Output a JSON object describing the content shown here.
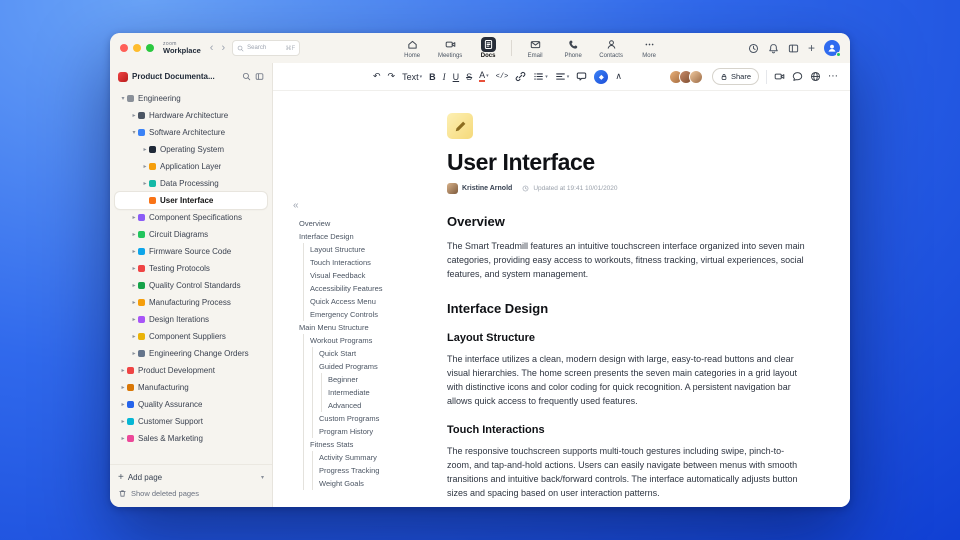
{
  "titlebar": {
    "brand_small": "zoom",
    "brand_name": "Workplace",
    "back_glyph": "‹",
    "forward_glyph": "›",
    "plus_glyph": "+",
    "search": {
      "placeholder": "Search",
      "shortcut": "⌘F"
    },
    "tabs": [
      {
        "label": "Home",
        "icon": "home-icon"
      },
      {
        "label": "Meetings",
        "icon": "video-camera-icon"
      },
      {
        "label": "Docs",
        "icon": "document-icon",
        "active": true,
        "divider_after": true
      },
      {
        "label": "Email",
        "icon": "envelope-icon"
      },
      {
        "label": "Phone",
        "icon": "phone-icon"
      },
      {
        "label": "Contacts",
        "icon": "contacts-icon"
      },
      {
        "label": "More",
        "icon": "more-dots-icon"
      }
    ]
  },
  "sidebar": {
    "workspace_title": "Product Documenta...",
    "add_page_label": "Add page",
    "add_page_plus_glyph": "+",
    "add_page_chevron_glyph": "▾",
    "show_deleted_label": "Show deleted pages",
    "tree": [
      {
        "label": "Engineering",
        "depth": 0,
        "chevron": "down",
        "icon": "gear-icon",
        "color": "#8a9099"
      },
      {
        "label": "Hardware Architecture",
        "depth": 1,
        "chevron": "right",
        "icon": "chip-icon",
        "color": "#4b5563"
      },
      {
        "label": "Software Architecture",
        "depth": 1,
        "chevron": "down",
        "icon": "layers-icon",
        "color": "#3b82f6"
      },
      {
        "label": "Operating System",
        "depth": 2,
        "chevron": "right",
        "icon": "cpu-icon",
        "color": "#1f2937"
      },
      {
        "label": "Application Layer",
        "depth": 2,
        "chevron": "right",
        "icon": "window-icon",
        "color": "#f59e0b"
      },
      {
        "label": "Data Processing",
        "depth": 2,
        "chevron": "right",
        "icon": "database-icon",
        "color": "#14b8a6"
      },
      {
        "label": "User Interface",
        "depth": 2,
        "chevron": "none",
        "icon": "palette-icon",
        "color": "#f97316",
        "selected": true
      },
      {
        "label": "Component Specifications",
        "depth": 1,
        "chevron": "right",
        "icon": "clipboard-icon",
        "color": "#8b5cf6"
      },
      {
        "label": "Circuit Diagrams",
        "depth": 1,
        "chevron": "right",
        "icon": "circuit-icon",
        "color": "#22c55e"
      },
      {
        "label": "Firmware Source Code",
        "depth": 1,
        "chevron": "right",
        "icon": "code-file-icon",
        "color": "#0ea5e9"
      },
      {
        "label": "Testing Protocols",
        "depth": 1,
        "chevron": "right",
        "icon": "flask-icon",
        "color": "#ef4444"
      },
      {
        "label": "Quality Control Standards",
        "depth": 1,
        "chevron": "right",
        "icon": "check-badge-icon",
        "color": "#16a34a"
      },
      {
        "label": "Manufacturing Process",
        "depth": 1,
        "chevron": "right",
        "icon": "factory-icon",
        "color": "#f59e0b"
      },
      {
        "label": "Design Iterations",
        "depth": 1,
        "chevron": "right",
        "icon": "loop-icon",
        "color": "#a855f7"
      },
      {
        "label": "Component Suppliers",
        "depth": 1,
        "chevron": "right",
        "icon": "box-icon",
        "color": "#eab308"
      },
      {
        "label": "Engineering Change Orders",
        "depth": 1,
        "chevron": "right",
        "icon": "file-icon",
        "color": "#64748b"
      },
      {
        "label": "Product Development",
        "depth": 0,
        "chevron": "right",
        "icon": "rocket-icon",
        "color": "#ef4444"
      },
      {
        "label": "Manufacturing",
        "depth": 0,
        "chevron": "right",
        "icon": "wrench-icon",
        "color": "#d97706"
      },
      {
        "label": "Quality Assurance",
        "depth": 0,
        "chevron": "right",
        "icon": "shield-icon",
        "color": "#2563eb"
      },
      {
        "label": "Customer Support",
        "depth": 0,
        "chevron": "right",
        "icon": "headset-icon",
        "color": "#06b6d4"
      },
      {
        "label": "Sales & Marketing",
        "depth": 0,
        "chevron": "right",
        "icon": "chart-icon",
        "color": "#ec4899"
      }
    ]
  },
  "outline": {
    "collapse_glyph": "«",
    "items": [
      {
        "label": "Overview",
        "level": 0
      },
      {
        "label": "Interface Design",
        "level": 0
      },
      {
        "label": "Layout Structure",
        "level": 1
      },
      {
        "label": "Touch Interactions",
        "level": 1
      },
      {
        "label": "Visual Feedback",
        "level": 1
      },
      {
        "label": "Accessibility Features",
        "level": 1
      },
      {
        "label": "Quick Access Menu",
        "level": 1
      },
      {
        "label": "Emergency Controls",
        "level": 1
      },
      {
        "label": "Main Menu Structure",
        "level": 0
      },
      {
        "label": "Workout Programs",
        "level": 1
      },
      {
        "label": "Quick Start",
        "level": 2
      },
      {
        "label": "Guided Programs",
        "level": 2
      },
      {
        "label": "Beginner",
        "level": 3
      },
      {
        "label": "Intermediate",
        "level": 3
      },
      {
        "label": "Advanced",
        "level": 3
      },
      {
        "label": "Custom Programs",
        "level": 2
      },
      {
        "label": "Program History",
        "level": 2
      },
      {
        "label": "Fitness Stats",
        "level": 1
      },
      {
        "label": "Activity Summary",
        "level": 2
      },
      {
        "label": "Progress Tracking",
        "level": 2
      },
      {
        "label": "Weight Goals",
        "level": 2
      }
    ]
  },
  "toolbar": {
    "undo_glyph": "↶",
    "redo_glyph": "↷",
    "text_style_label": "Text",
    "caret_glyph": "▾",
    "bold_label": "B",
    "italic_label": "I",
    "underline_label": "U",
    "strikethrough_label": "S",
    "text_color_label": "A",
    "code_label": "</>",
    "ai_glyph": "◆",
    "collapse_glyph": "∧",
    "share_label": "Share",
    "more_glyph": "⋯"
  },
  "document": {
    "title": "User Interface",
    "author": "Kristine Arnold",
    "updated": "Updated at 19:41 10/01/2020",
    "sections": [
      {
        "type": "h2",
        "text": "Overview"
      },
      {
        "type": "p",
        "text": "The Smart Treadmill features an intuitive touchscreen interface organized into seven main categories, providing easy access to workouts, fitness tracking, virtual experiences, social features, and system management."
      },
      {
        "type": "h2",
        "text": "Interface Design"
      },
      {
        "type": "h3",
        "text": "Layout Structure"
      },
      {
        "type": "p",
        "text": "The interface utilizes a clean, modern design with large, easy-to-read buttons and clear visual hierarchies. The home screen presents the seven main categories in a grid layout with distinctive icons and color coding for quick recognition. A persistent navigation bar allows quick access to frequently used features."
      },
      {
        "type": "h3",
        "text": "Touch Interactions"
      },
      {
        "type": "p",
        "text": "The responsive touchscreen supports multi-touch gestures including swipe, pinch-to-zoom, and tap-and-hold actions. Users can easily navigate between menus with smooth transitions and intuitive back/forward controls. The interface automatically adjusts button sizes and spacing based on user interaction patterns."
      }
    ]
  }
}
